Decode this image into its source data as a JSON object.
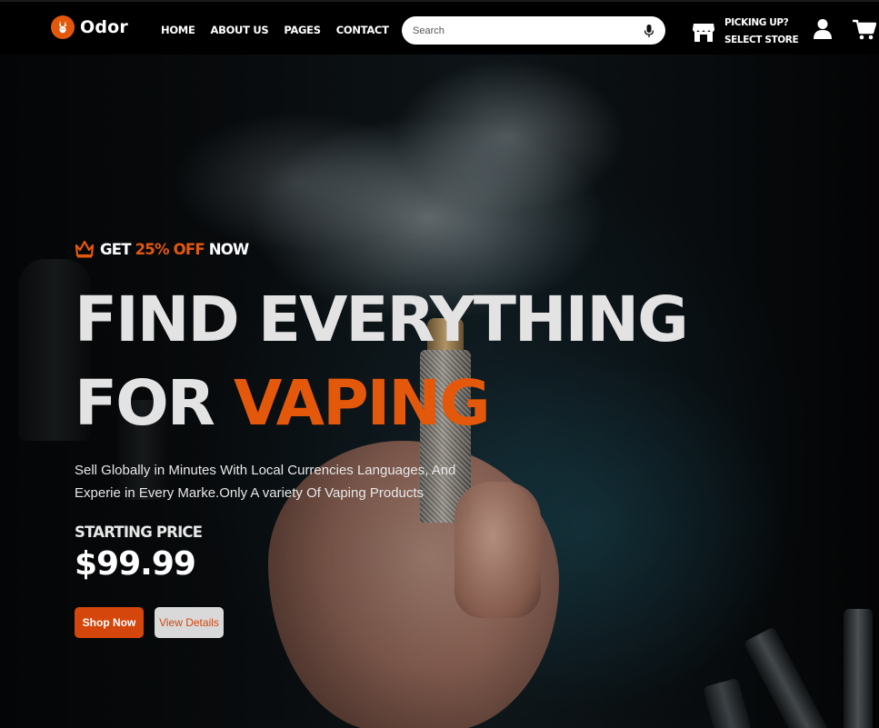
{
  "header": {
    "brand": "Odor",
    "nav": [
      {
        "label": "HOME"
      },
      {
        "label": "ABOUT US"
      },
      {
        "label": "PAGES"
      },
      {
        "label": "CONTACT"
      }
    ],
    "search": {
      "placeholder": "Search",
      "value": ""
    },
    "store": {
      "line1": "PICKING UP?",
      "line2": "SELECT STORE"
    },
    "icons": [
      "rabbit-logo-icon",
      "mic-icon",
      "store-icon",
      "user-icon",
      "cart-icon"
    ]
  },
  "hero": {
    "promo": {
      "prefix": "GET ",
      "highlight": "25% OFF",
      "suffix": " NOW",
      "icon": "crown-icon"
    },
    "headline": {
      "line1": "FIND EVERYTHING",
      "line2_prefix": "FOR ",
      "line2_accent": "VAPING"
    },
    "description": "Sell Globally in Minutes With Local Currencies Languages, And Experie in Every Marke.Only A variety Of Vaping Products",
    "price_label": "STARTING PRICE",
    "price": "$99.99",
    "buttons": {
      "primary": "Shop Now",
      "secondary": "View Details"
    }
  },
  "colors": {
    "accent": "#e4580b",
    "button_primary": "#d4460b",
    "header_bg": "#000000",
    "headline": "#e3e3e3"
  }
}
